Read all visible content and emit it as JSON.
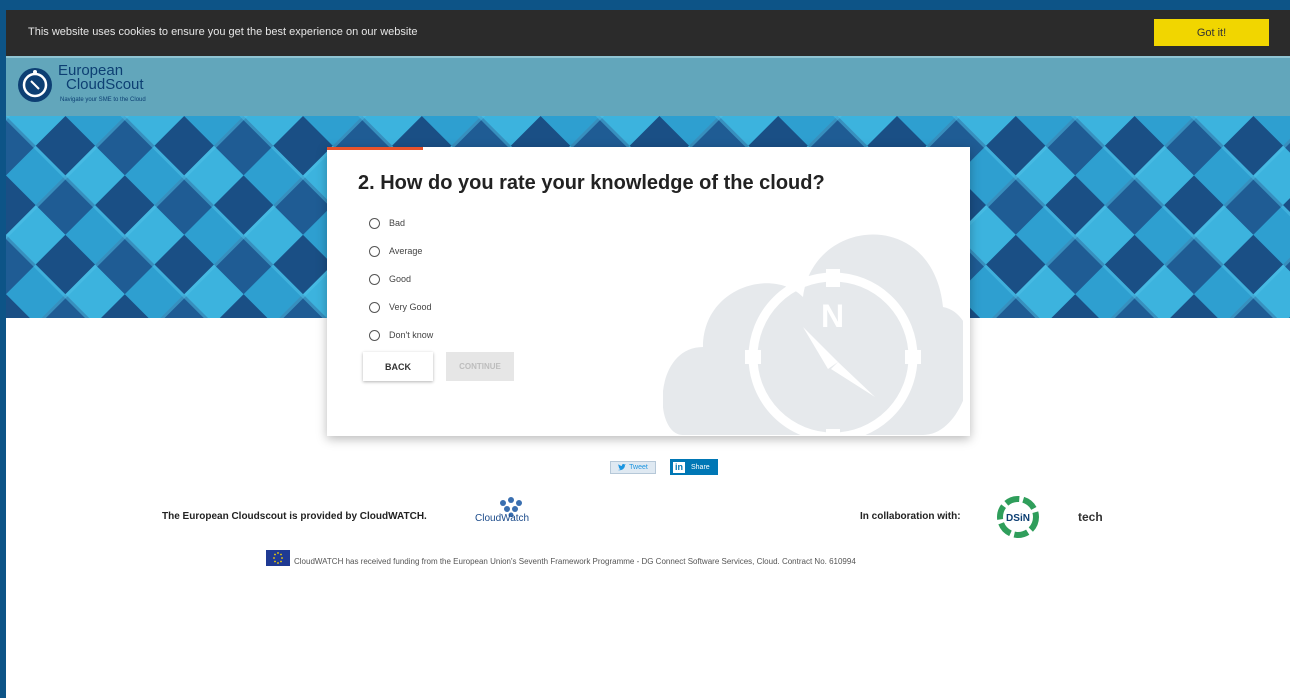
{
  "cookie_bar": {
    "message": "This website uses cookies to ensure you get the best experience on our website",
    "accept_label": "Got it!"
  },
  "header": {
    "logo_line1": "European",
    "logo_line2": "CloudScout",
    "logo_tagline": "Navigate your SME to the Cloud"
  },
  "question": {
    "title": "2. How do you rate your knowledge of the cloud?",
    "options": [
      {
        "label": "Bad"
      },
      {
        "label": "Average"
      },
      {
        "label": "Good"
      },
      {
        "label": "Very Good"
      },
      {
        "label": "Don't know"
      }
    ],
    "back_label": "BACK",
    "continue_label": "CONTINUE"
  },
  "social": {
    "tweet_label": "Tweet",
    "share_label": "Share",
    "linkedin_badge": "in"
  },
  "footer": {
    "provided_by": "The European Cloudscout is provided by CloudWATCH.",
    "cloudwatch_logo_text": "CloudWatch",
    "collaboration": "In collaboration with:",
    "dsin_logo_text": "DSiN",
    "tech_logo_text": "tech",
    "funding": "CloudWATCH has received funding from the European Union's Seventh Framework Programme - DG Connect Software Services, Cloud. Contract No. 610994"
  },
  "colors": {
    "frame": "#0d5487",
    "cookie_bar": "#2b2b2b",
    "cookie_button": "#f1d600",
    "header": "#62a6bb",
    "progress_accent": "#e8532b",
    "linkedin": "#0077b5"
  }
}
